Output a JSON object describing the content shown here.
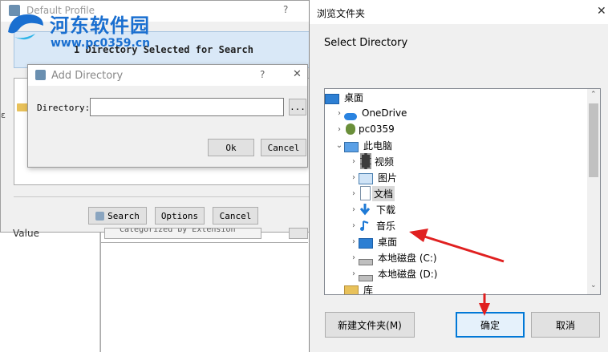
{
  "profile": {
    "title": "Default Profile",
    "help": "?",
    "banner": "1 Directory Selected for Search",
    "search_label": "Search",
    "options_label": "Options",
    "cancel_label": "Cancel",
    "side_value": "Value",
    "group_dropdown": "Categorized by Extension"
  },
  "add_dir": {
    "title": "Add Directory",
    "help": "?",
    "close": "✕",
    "directory_label": "Directory:",
    "directory_value": "",
    "browse_label": "...",
    "ok_label": "Ok",
    "cancel_label": "Cancel"
  },
  "watermark": {
    "name": "河东软件园",
    "url": "www.pc0359.cn"
  },
  "browse": {
    "title": "浏览文件夹",
    "close": "✕",
    "prompt": "Select Directory",
    "tree": [
      {
        "label": "桌面",
        "icon": "desktop-icon",
        "level": 0,
        "chev": ""
      },
      {
        "label": "OneDrive",
        "icon": "cloud-icon",
        "level": 1,
        "chev": "›"
      },
      {
        "label": "pc0359",
        "icon": "user-icon",
        "level": 1,
        "chev": "›"
      },
      {
        "label": "此电脑",
        "icon": "computer-icon",
        "level": 1,
        "chev": "⌄"
      },
      {
        "label": "视频",
        "icon": "video-icon",
        "level": 2,
        "chev": "›"
      },
      {
        "label": "图片",
        "icon": "pictures-icon",
        "level": 2,
        "chev": "›"
      },
      {
        "label": "文档",
        "icon": "documents-icon",
        "level": 2,
        "chev": "›"
      },
      {
        "label": "下载",
        "icon": "download-icon",
        "level": 2,
        "chev": "›"
      },
      {
        "label": "音乐",
        "icon": "music-icon",
        "level": 2,
        "chev": "›"
      },
      {
        "label": "桌面",
        "icon": "desktop-icon",
        "level": 2,
        "chev": "›"
      },
      {
        "label": "本地磁盘 (C:)",
        "icon": "drive-icon",
        "level": 2,
        "chev": "›"
      },
      {
        "label": "本地磁盘 (D:)",
        "icon": "drive-icon",
        "level": 2,
        "chev": "›"
      },
      {
        "label": "库",
        "icon": "library-icon",
        "level": 1,
        "chev": ""
      }
    ],
    "selected_index": 6,
    "new_folder_label": "新建文件夹(M)",
    "ok_label": "确定",
    "cancel_label": "取消"
  },
  "colors": {
    "accent": "#0078d7",
    "annotation": "#e02020",
    "watermark": "#1a6fd0"
  }
}
